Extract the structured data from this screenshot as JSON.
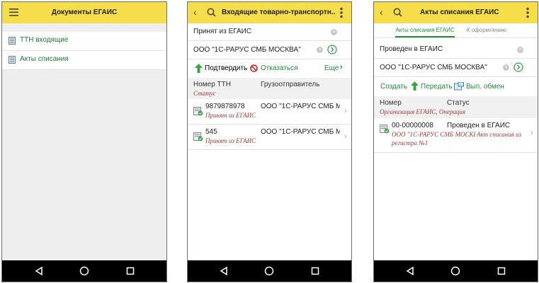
{
  "screen1": {
    "title": "Документы ЕГАИС",
    "menu": [
      {
        "label": "ТТН входящие"
      },
      {
        "label": "Акты списания"
      }
    ]
  },
  "screen2": {
    "title": "Входящие товарно-транспортн...",
    "filter_status": "Принят из ЕГАИС",
    "filter_org": "ООО \"1С-РАРУС СМБ МОСКВА\"",
    "actions": {
      "confirm": "Подтвердить",
      "reject": "Отказаться",
      "more": "Еще"
    },
    "columns": {
      "number": "Номер ТТН",
      "status": "Статус",
      "shipper": "Грузоотправитель"
    },
    "rows": [
      {
        "number": "9879878978",
        "status": "Принят из ЕГАИС",
        "shipper": "ООО \"1С-РАРУС СМБ М..."
      },
      {
        "number": "545",
        "status": "Принят из ЕГАИС",
        "shipper": "ООО \"1С-РАРУС СМБ М..."
      }
    ]
  },
  "screen3": {
    "title": "Акты списания ЕГАИС",
    "tabs": [
      "Акты списания ЕГАИС",
      "К оформлению"
    ],
    "filter_status": "Проведен в ЕГАИС",
    "filter_org": "ООО \"1С-РАРУС СМБ МОСКВА\"",
    "actions": {
      "create": "Создать",
      "send": "Передать",
      "exchange": "Вып. обмен"
    },
    "columns": {
      "number": "Номер",
      "status": "Статус",
      "sub": "Организация ЕГАИС, Операция"
    },
    "rows": [
      {
        "number": "00-00000008",
        "status": "Проведен в ЕГАИС",
        "org": "ООО \"1С-РАРУС СМБ МОСКВА\",",
        "op1": "Акт списания из",
        "op2": "регистра №1"
      }
    ]
  },
  "colors": {
    "topbar": "#f6dd4a",
    "navbar": "#000000",
    "accent_green": "#1f8f3a",
    "reject_red": "#d12020"
  }
}
